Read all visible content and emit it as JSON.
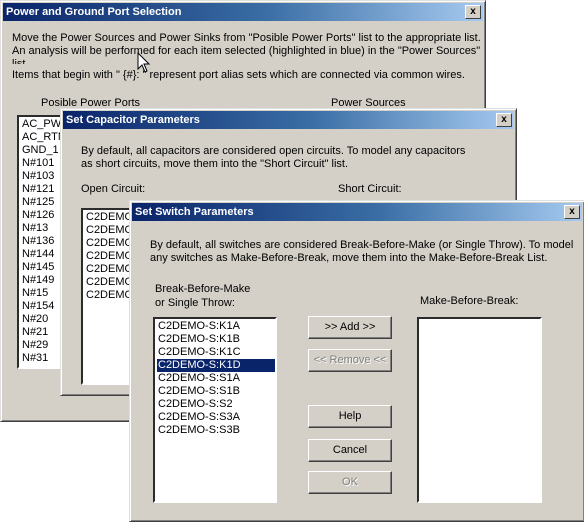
{
  "dialog1": {
    "title": "Power and Ground Port Selection",
    "close": "x",
    "instr1": "Move the Power Sources and Power Sinks from \"Posible Power Ports\" list to the appropriate list.",
    "instr2": "An analysis will be performed for each item selected (highlighted in blue) in the \"Power Sources\"",
    "instr3": "list.",
    "instr4": "Items that begin with \" {#}: \" represent port alias sets which are connected via common wires.",
    "left_label": "Posible Power Ports",
    "right_label": "Power Sources",
    "ports": [
      "AC_PW",
      "AC_RTN",
      "GND_1",
      "N#101",
      "N#103",
      "N#121",
      "N#125",
      "N#126",
      "N#13",
      "N#136",
      "N#144",
      "N#145",
      "N#149",
      "N#15",
      "N#154",
      "N#20",
      "N#21",
      "N#29",
      "N#31"
    ]
  },
  "dialog2": {
    "title": "Set Capacitor Parameters",
    "close": "x",
    "instr1": "By default, all capacitors are considered open circuits.  To model any capacitors",
    "instr2": "as short circuits, move them into the \"Short Circuit\" list.",
    "open_label": "Open Circuit:",
    "short_label": "Short Circuit:",
    "open_items": [
      "C2DEMO",
      "C2DEMO",
      "C2DEMO",
      "C2DEMO",
      "C2DEMO",
      "C2DEMO",
      "C2DEMO"
    ]
  },
  "dialog3": {
    "title": "Set Switch Parameters",
    "close": "x",
    "instr1": "By default, all switches are considered Break-Before-Make (or Single Throw).  To model",
    "instr2": "any switches as Make-Before-Break, move them into the Make-Before-Break List.",
    "bbm_label1": "Break-Before-Make",
    "bbm_label2": "or Single Throw:",
    "mbb_label": "Make-Before-Break:",
    "bbm_items": [
      "C2DEMO-S:K1A",
      "C2DEMO-S:K1B",
      "C2DEMO-S:K1C",
      "C2DEMO-S:K1D",
      "C2DEMO-S:S1A",
      "C2DEMO-S:S1B",
      "C2DEMO-S:S2",
      "C2DEMO-S:S3A",
      "C2DEMO-S:S3B"
    ],
    "selected_item": "C2DEMO-S:K1D",
    "add_label": ">> Add  >>",
    "remove_label": "<< Remove <<",
    "help_label": "Help",
    "cancel_label": "Cancel",
    "ok_label": "OK"
  },
  "colors": {
    "dialog_face": "#d4d0c8",
    "title_active_start": "#0a246a",
    "title_active_end": "#a6caf0",
    "selection": "#0a246a"
  },
  "icons": [
    "close-icon",
    "mouse-cursor-icon"
  ]
}
